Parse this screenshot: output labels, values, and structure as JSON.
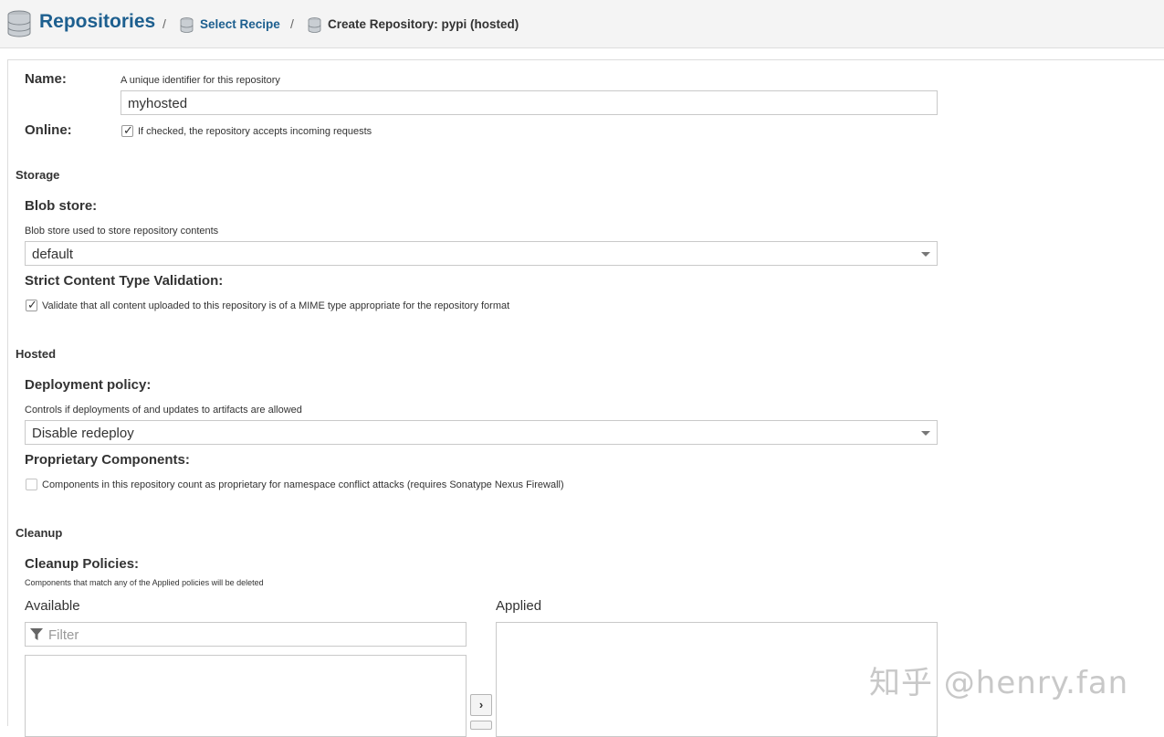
{
  "breadcrumb": {
    "root": "Repositories",
    "step1": "Select Recipe",
    "current": "Create Repository: pypi (hosted)",
    "separator": "/"
  },
  "name_field": {
    "label": "Name:",
    "help": "A unique identifier for this repository",
    "value": "myhosted"
  },
  "online_field": {
    "label": "Online:",
    "checked": true,
    "help": "If checked, the repository accepts incoming requests"
  },
  "storage": {
    "section": "Storage",
    "blob_label": "Blob store:",
    "blob_help": "Blob store used to store repository contents",
    "blob_value": "default",
    "strict_label": "Strict Content Type Validation:",
    "strict_checked": true,
    "strict_help": "Validate that all content uploaded to this repository is of a MIME type appropriate for the repository format"
  },
  "hosted": {
    "section": "Hosted",
    "deploy_label": "Deployment policy:",
    "deploy_help": "Controls if deployments of and updates to artifacts are allowed",
    "deploy_value": "Disable redeploy",
    "prop_label": "Proprietary Components:",
    "prop_checked": false,
    "prop_help": "Components in this repository count as proprietary for namespace conflict attacks (requires Sonatype Nexus Firewall)"
  },
  "cleanup": {
    "section": "Cleanup",
    "policies_label": "Cleanup Policies:",
    "policies_help": "Components that match any of the Applied policies will be deleted",
    "available_label": "Available",
    "applied_label": "Applied",
    "filter_placeholder": "Filter",
    "move_right": "›"
  },
  "watermark": "知乎 @henry.fan",
  "colors": {
    "link": "#1d5f8f",
    "header_bg": "#f4f4f4",
    "border": "#c9c9c9"
  },
  "icons": [
    "database-icon",
    "filter-icon",
    "chevron-right-icon",
    "chevron-down-icon",
    "checkmark-icon"
  ]
}
